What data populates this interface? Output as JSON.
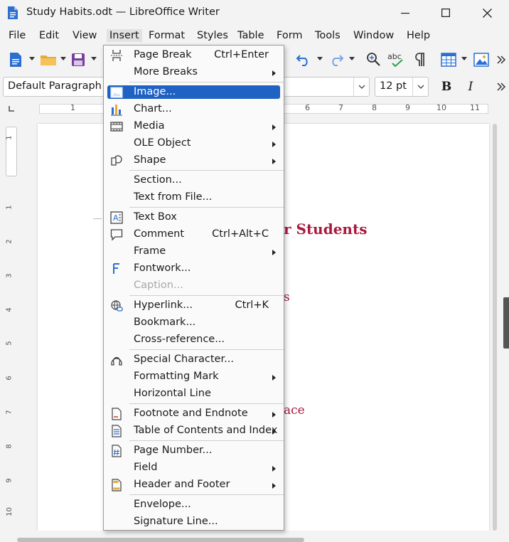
{
  "window": {
    "title": "Study Habits.odt — LibreOffice Writer"
  },
  "menubar": [
    "File",
    "Edit",
    "View",
    "Insert",
    "Format",
    "Styles",
    "Table",
    "Form",
    "Tools",
    "Window",
    "Help"
  ],
  "formatting": {
    "paragraph_style": "Default Paragraph St",
    "font_size": "12 pt",
    "bold_label": "B",
    "italic_label": "I"
  },
  "ruler_numbers": [
    "1",
    "6",
    "7",
    "8",
    "9",
    "10",
    "11"
  ],
  "vruler_numbers": [
    "1",
    "1",
    "2",
    "3",
    "4",
    "5",
    "6",
    "7",
    "8",
    "9",
    "10"
  ],
  "document": {
    "heading_fragment": "r Students",
    "line2_fragment": "s",
    "line3_fragment": "ace"
  },
  "insert_menu": {
    "items": [
      {
        "label": "Page Break",
        "shortcut": "Ctrl+Enter",
        "icon": "page-break-icon"
      },
      {
        "label": "More Breaks",
        "submenu": true
      },
      {
        "label": "Image...",
        "icon": "image-icon",
        "highlighted": true
      },
      {
        "label": "Chart...",
        "icon": "chart-icon"
      },
      {
        "label": "Media",
        "icon": "media-icon",
        "submenu": true
      },
      {
        "label": "OLE Object",
        "submenu": true
      },
      {
        "label": "Shape",
        "icon": "shape-icon",
        "submenu": true
      },
      {
        "label": "Section..."
      },
      {
        "label": "Text from File..."
      },
      {
        "label": "Text Box",
        "icon": "text-box-icon"
      },
      {
        "label": "Comment",
        "shortcut": "Ctrl+Alt+C",
        "icon": "comment-icon"
      },
      {
        "label": "Frame",
        "submenu": true
      },
      {
        "label": "Fontwork...",
        "icon": "fontwork-icon"
      },
      {
        "label": "Caption...",
        "disabled": true
      },
      {
        "label": "Hyperlink...",
        "shortcut": "Ctrl+K",
        "icon": "hyperlink-icon"
      },
      {
        "label": "Bookmark..."
      },
      {
        "label": "Cross-reference..."
      },
      {
        "label": "Special Character...",
        "icon": "special-character-icon"
      },
      {
        "label": "Formatting Mark",
        "submenu": true
      },
      {
        "label": "Horizontal Line"
      },
      {
        "label": "Footnote and Endnote",
        "icon": "footnote-icon",
        "submenu": true
      },
      {
        "label": "Table of Contents and Index",
        "icon": "toc-icon",
        "submenu": true
      },
      {
        "label": "Page Number...",
        "icon": "page-number-icon"
      },
      {
        "label": "Field",
        "submenu": true
      },
      {
        "label": "Header and Footer",
        "icon": "header-footer-icon",
        "submenu": true
      },
      {
        "label": "Envelope..."
      },
      {
        "label": "Signature Line..."
      }
    ]
  },
  "colors": {
    "highlight": "#1f62c4",
    "doc_text": "#a8193f",
    "accent_blue": "#2a6fd1"
  }
}
